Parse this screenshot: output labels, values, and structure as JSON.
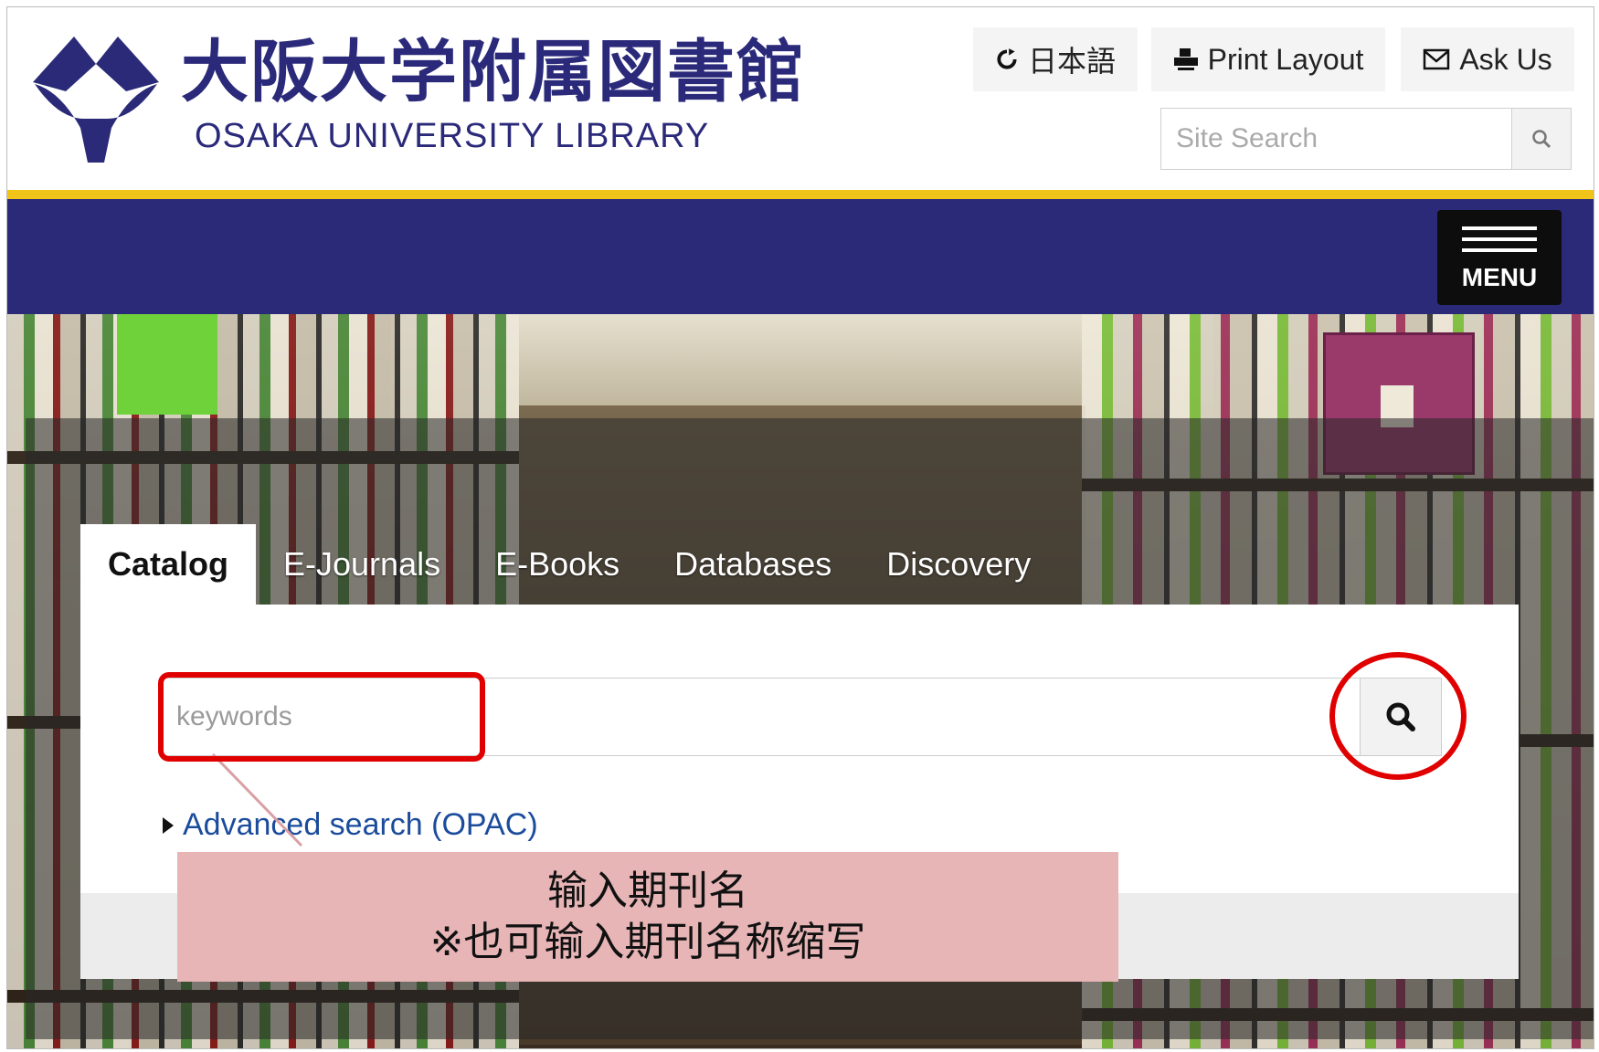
{
  "header": {
    "logo_jp": "大阪大学附属図書館",
    "logo_en": "OSAKA UNIVERSITY LIBRARY",
    "utility": {
      "language_label": "日本語",
      "print_label": "Print Layout",
      "ask_label": "Ask Us"
    },
    "site_search": {
      "placeholder": "Site Search",
      "value": ""
    },
    "menu_label": "MENU"
  },
  "search_widget": {
    "tabs": [
      {
        "label": "Catalog",
        "active": true
      },
      {
        "label": "E-Journals",
        "active": false
      },
      {
        "label": "E-Books",
        "active": false
      },
      {
        "label": "Databases",
        "active": false
      },
      {
        "label": "Discovery",
        "active": false
      }
    ],
    "keyword_placeholder": "keywords",
    "keyword_value": "",
    "advanced_link": "Advanced search (OPAC)"
  },
  "annotation": {
    "line1": "输入期刊名",
    "line2": "※也可输入期刊名称缩写"
  },
  "colors": {
    "brand_navy": "#2b2a78",
    "accent_yellow": "#f0c419",
    "highlight_red": "#e00000",
    "callout_pink": "#e8b5b7",
    "link_blue": "#1b4c9c"
  },
  "icons": {
    "language": "refresh-icon",
    "print": "print-icon",
    "ask": "envelope-icon",
    "site_search": "search-icon",
    "menu": "hamburger-icon",
    "keyword_search": "search-icon"
  }
}
